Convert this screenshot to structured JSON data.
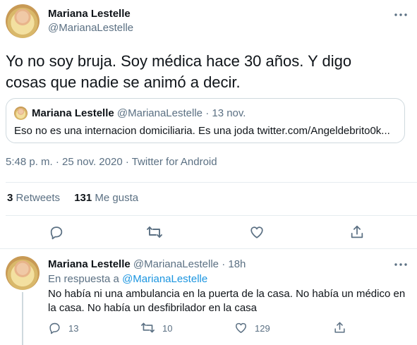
{
  "main_tweet": {
    "author_name": "Mariana Lestelle",
    "author_handle": "@MarianaLestelle",
    "text": "Yo no soy bruja. Soy médica hace 30 años. Y digo cosas que nadie se animó a decir.",
    "quoted": {
      "author_name": "Mariana Lestelle",
      "author_handle": "@MarianaLestelle",
      "date": "· 13 nov.",
      "text": "Eso no es una internacion domiciliaria. Es una joda twitter.com/Angeldebrito0k..."
    },
    "timestamp": "5:48 p. m. · 25 nov. 2020 · Twitter for Android",
    "stats": {
      "retweets_count": "3",
      "retweets_label": "Retweets",
      "likes_count": "131",
      "likes_label": "Me gusta"
    }
  },
  "reply_tweet": {
    "author_name": "Mariana Lestelle",
    "author_handle": "@MarianaLestelle",
    "time": "· 18h",
    "reply_prefix": "En respuesta a",
    "reply_to": "@MarianaLestelle",
    "text": "No había ni una ambulancia en la puerta de la casa. No había un médico en la casa. No había un desfibrilador en la casa",
    "reply_count": "13",
    "retweet_count": "10",
    "like_count": "129"
  },
  "colors": {
    "text": "#0f1419",
    "muted": "#5b7083",
    "link": "#1b95e0",
    "border": "#e6ecf0"
  }
}
